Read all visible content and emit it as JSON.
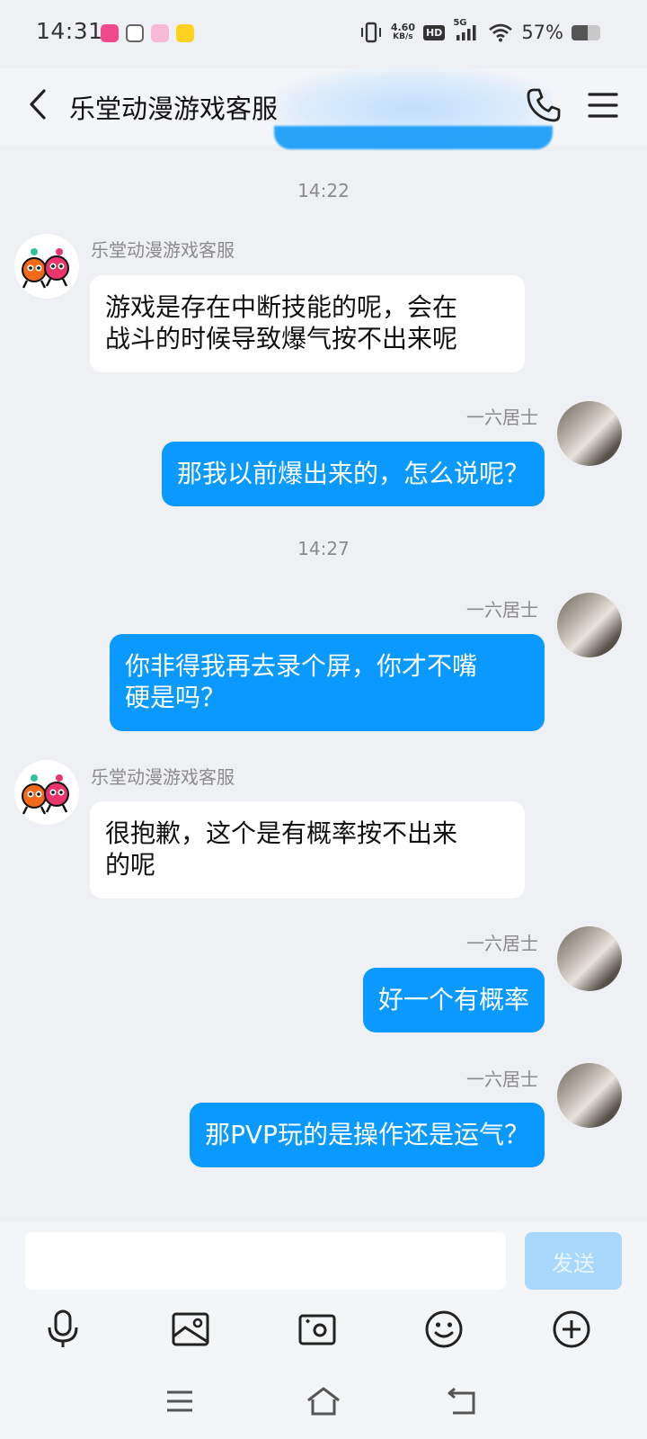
{
  "status_bar": {
    "time": "14:31",
    "network_speed_value": "4.60",
    "network_speed_unit": "KB/s",
    "hd_badge": "HD",
    "network_type": "5G",
    "battery_percent": "57%",
    "battery_level": 0.57
  },
  "header": {
    "title": "乐堂动漫游戏客服"
  },
  "chat": {
    "time_1": "14:22",
    "time_2": "14:27",
    "messages": [
      {
        "sender": "乐堂动漫游戏客服",
        "text_line1": "游戏是存在中断技能的呢，会在",
        "text_line2": "战斗的时候导致爆气按不出来呢"
      },
      {
        "sender": "一六居士",
        "text": "那我以前爆出来的，怎么说呢？"
      },
      {
        "sender": "一六居士",
        "text_line1": "你非得我再去录个屏，你才不嘴",
        "text_line2": "硬是吗？"
      },
      {
        "sender": "乐堂动漫游戏客服",
        "text_line1": "很抱歉，这个是有概率按不出来",
        "text_line2": "的呢"
      },
      {
        "sender": "一六居士",
        "text": "好一个有概率"
      },
      {
        "sender": "一六居士",
        "text": "那PVP玩的是操作还是运气？"
      }
    ]
  },
  "input": {
    "value": "",
    "send_label": "发送"
  },
  "colors": {
    "accent": "#0a99ff",
    "send_disabled": "#a8d8fb",
    "background": "#eff0f4"
  },
  "toolbar": {
    "icons": [
      "microphone-icon",
      "photo-icon",
      "camera-icon",
      "emoji-icon",
      "plus-icon"
    ]
  },
  "navbar": {
    "icons": [
      "recent-apps-icon",
      "home-icon",
      "back-icon"
    ]
  }
}
